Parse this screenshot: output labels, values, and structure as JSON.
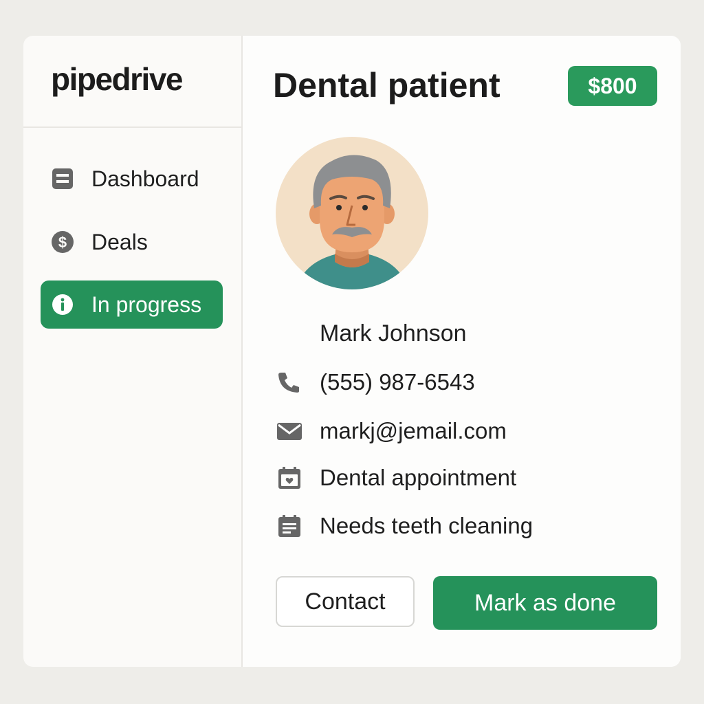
{
  "app": {
    "logo_text": "pipedrive"
  },
  "sidebar": {
    "items": [
      {
        "label": "Dashboard",
        "icon": "dashboard-icon",
        "active": false
      },
      {
        "label": "Deals",
        "icon": "dollar-icon",
        "active": false
      },
      {
        "label": "In progress",
        "icon": "info-icon",
        "active": true
      }
    ]
  },
  "deal": {
    "title": "Dental patient",
    "amount": "$800",
    "contact_name": "Mark Johnson",
    "details": [
      {
        "icon": "phone-icon",
        "text": "(555) 987-6543"
      },
      {
        "icon": "mail-icon",
        "text": "markj@jemail.com"
      },
      {
        "icon": "calendar-icon",
        "text": "Dental appointment"
      },
      {
        "icon": "note-icon",
        "text": "Needs teeth cleaning"
      }
    ]
  },
  "actions": {
    "contact_label": "Contact",
    "done_label": "Mark as done"
  },
  "colors": {
    "accent": "#25925a",
    "badge": "#2a9a5c",
    "icon_gray": "#666666",
    "background": "#eeede9"
  }
}
